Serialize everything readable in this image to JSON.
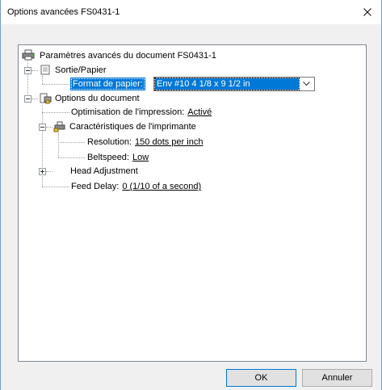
{
  "window": {
    "title": "Options avancées FS0431-1",
    "close_glyph": "×"
  },
  "tree": {
    "root_label": "Paramètres avancés du document FS0431-1",
    "sortie_label": "Sortie/Papier",
    "format_label": "Format de papier:",
    "format_value": "Env #10 4 1/8 x 9 1/2 in",
    "options_label": "Options du document",
    "optimisation_label": "Optimisation de l'impression:",
    "optimisation_value": "Activé",
    "caracteristiques_label": "Caractéristiques de l'imprimante",
    "resolution_label": "Resolution:",
    "resolution_value": "150 dots per inch",
    "beltspeed_label": "Beltspeed:",
    "beltspeed_value": "Low",
    "head_label": "Head Adjustment",
    "feed_label": "Feed Delay:",
    "feed_value": "0  (1/10 of a second)"
  },
  "buttons": {
    "ok": "OK",
    "cancel": "Annuler"
  },
  "colors": {
    "selection": "#0078d7",
    "border": "#828790"
  }
}
